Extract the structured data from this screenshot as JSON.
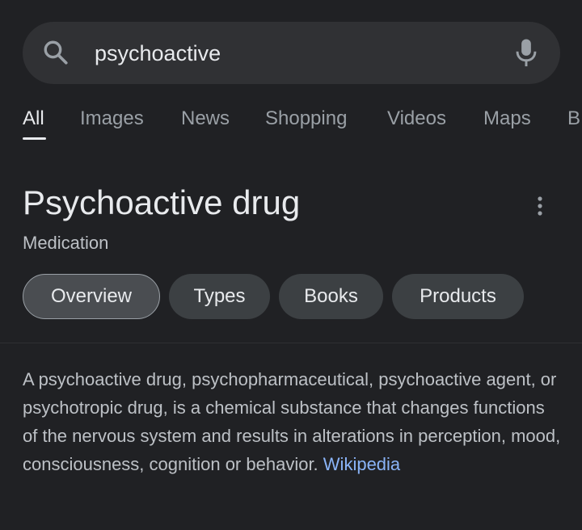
{
  "search": {
    "query": "psychoactive"
  },
  "tabs": [
    {
      "label": "All",
      "active": true
    },
    {
      "label": "Images"
    },
    {
      "label": "News"
    },
    {
      "label": "Shopping"
    },
    {
      "label": "Videos"
    },
    {
      "label": "Maps"
    },
    {
      "label": "B"
    }
  ],
  "knowledge_panel": {
    "title": "Psychoactive drug",
    "subtitle": "Medication",
    "chips": [
      {
        "label": "Overview",
        "selected": true
      },
      {
        "label": "Types"
      },
      {
        "label": "Books"
      },
      {
        "label": "Products"
      }
    ],
    "description": "A psychoactive drug, psychopharmaceutical, psychoactive agent, or psychotropic drug, is a chemical substance that changes functions of the nervous system and results in alterations in perception, mood, consciousness, cognition or behavior.",
    "source_link": "Wikipedia"
  },
  "colors": {
    "background": "#202124",
    "surface": "#303134",
    "chip": "#3c4043",
    "link": "#8ab4f8",
    "text_primary": "#e8eaed",
    "text_secondary": "#bdc1c6"
  }
}
